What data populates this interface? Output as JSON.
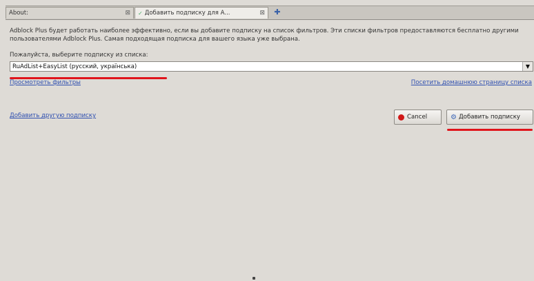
{
  "tabs": [
    {
      "label": "About:",
      "close": "⊠",
      "icon": "",
      "active": false
    },
    {
      "label": "Добавить подписку для А...",
      "close": "⊠",
      "icon": "✓",
      "active": true
    }
  ],
  "new_tab_icon": "✚",
  "intro_text": "Adblock Plus будет работать наиболее эффективно, если вы добавите подписку на список фильтров. Эти списки фильтров предоставляются бесплатно другими пользователями Adblock Plus. Самая подходящая подписка для вашего языка уже выбрана.",
  "choose_label": "Пожалуйста, выберите подписку из списка:",
  "subscription_select": {
    "selected": "RuAdList+EasyList (русский, українська)",
    "arrow": "▼"
  },
  "links": {
    "view_filters": "Просмотреть фильтры",
    "homepage": "Посетить домашнюю страницу списка",
    "add_other": "Добавить другую подписку"
  },
  "buttons": {
    "cancel": "Cancel",
    "add": "Добавить подписку"
  },
  "accent_colors": {
    "annotation_red": "#e0141b",
    "link_blue": "#2e4fb0"
  }
}
